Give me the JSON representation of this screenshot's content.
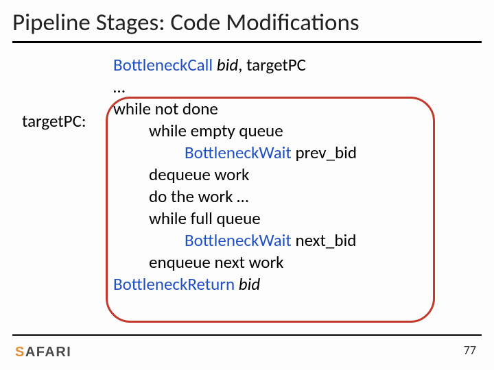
{
  "title": "Pipeline Stages: Code Modifications",
  "label": "targetPC:",
  "code": {
    "l1_kw": "BottleneckCall",
    "l1_arg": " bid",
    "l1_rest": ", targetPC",
    "l2": "…",
    "l3": "while not done",
    "l4": "while empty queue",
    "l5_kw": "BottleneckWait ",
    "l5_rest": "prev_bid",
    "l6": "dequeue work",
    "l7": "do the work …",
    "l8": "while full queue",
    "l9_kw": "BottleneckWait ",
    "l9_rest": "next_bid",
    "l10": "enqueue next work",
    "l11_kw": "BottleneckReturn",
    "l11_arg": " bid"
  },
  "logo": {
    "s": "S",
    "rest": "AFARI"
  },
  "page": "77"
}
